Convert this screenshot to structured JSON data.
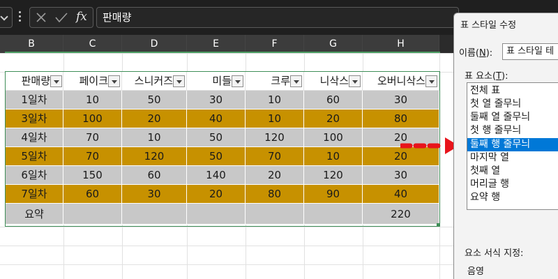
{
  "formula_bar": {
    "cancel_icon": "x-icon",
    "enter_icon": "checkmark-icon",
    "function_label": "fx",
    "value": "판매량"
  },
  "columns": [
    "B",
    "C",
    "D",
    "E",
    "F",
    "G",
    "H"
  ],
  "table": {
    "headers": [
      "판매량",
      "페이크",
      "스니커즈",
      "미들",
      "크루",
      "니삭스",
      "오버니삭스"
    ],
    "rows": [
      {
        "label": "1일차",
        "values": [
          "10",
          "50",
          "30",
          "10",
          "60",
          "30"
        ]
      },
      {
        "label": "3일차",
        "values": [
          "100",
          "20",
          "40",
          "10",
          "20",
          "80"
        ]
      },
      {
        "label": "4일차",
        "values": [
          "70",
          "10",
          "50",
          "120",
          "100",
          "20"
        ]
      },
      {
        "label": "5일차",
        "values": [
          "70",
          "120",
          "50",
          "70",
          "10",
          "20"
        ]
      },
      {
        "label": "6일차",
        "values": [
          "150",
          "60",
          "140",
          "20",
          "120",
          "30"
        ]
      },
      {
        "label": "7일차",
        "values": [
          "60",
          "30",
          "20",
          "80",
          "90",
          "40"
        ]
      }
    ],
    "summary": {
      "label": "요약",
      "values": [
        "",
        "",
        "",
        "",
        "",
        "220"
      ]
    }
  },
  "colors": {
    "band_gray": "#c8c8c8",
    "band_gold": "#c79100",
    "selection_green": "#3f8e58",
    "arrow_red": "#e8141b",
    "list_selected": "#0078d7"
  },
  "dialog": {
    "title": "표 스타일 수정",
    "name_label_prefix": "이름(",
    "name_label_key": "N",
    "name_label_suffix": "):",
    "name_value": "표 스타일 테",
    "elements_label_prefix": "표 요소(",
    "elements_label_key": "T",
    "elements_label_suffix": "):",
    "elements": [
      "전체 표",
      "첫 열 줄무늬",
      "둘째 열 줄무늬",
      "첫 행 줄무늬",
      "둘째 행 줄무늬",
      "마지막 열",
      "첫째 열",
      "머리글 행",
      "요약 행"
    ],
    "selected_element": "둘째 행 줄무늬",
    "format_label": "요소 서식 지정:",
    "shading_label": "음영"
  }
}
